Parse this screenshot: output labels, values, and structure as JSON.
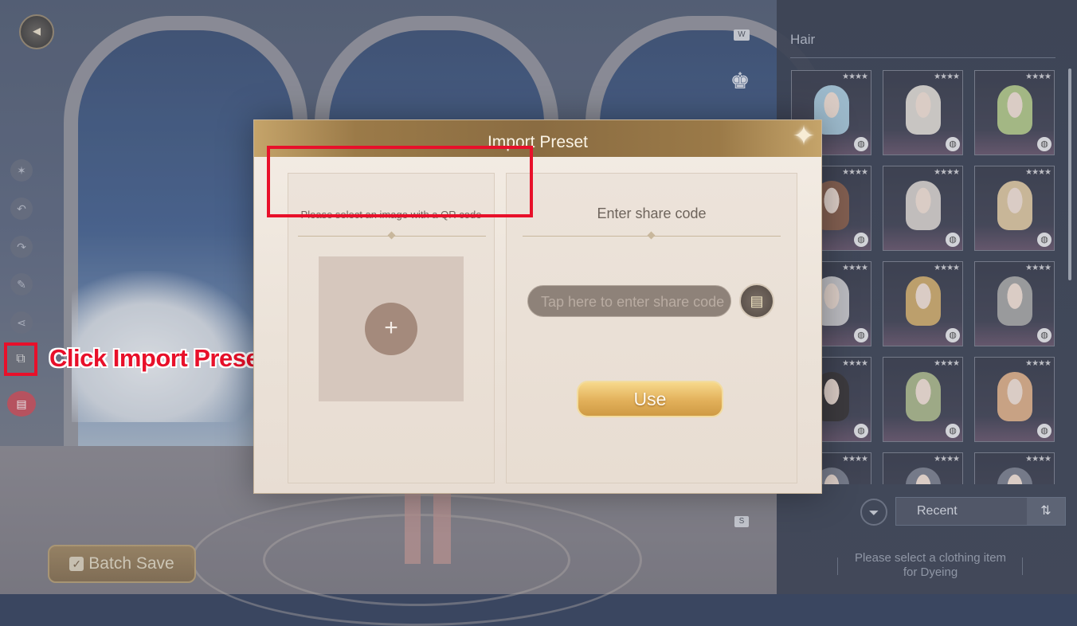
{
  "scene": {
    "key_w": "W",
    "key_s": "S",
    "outfit_icon": "outfit-icon"
  },
  "left_toolbar": {
    "back_icon": "back-arrow-icon",
    "tools": [
      "sparkle-icon",
      "undo-icon",
      "redo-icon",
      "brush-icon",
      "share-icon"
    ],
    "import_tool_icon": "import-icon",
    "book_icon": "book-icon",
    "batch_save_label": "Batch Save"
  },
  "annotation": {
    "instruction": "Click Import Preset button",
    "highlight_color": "#e8102a"
  },
  "right_panel": {
    "section_title": "Hair",
    "sort_label": "Recent",
    "dye_hint_line1": "Please select a clothing item",
    "dye_hint_line2": "for Dyeing",
    "hair_items": [
      {
        "stars": "★★★★",
        "color": "#9ec3d8"
      },
      {
        "stars": "★★★★",
        "color": "#d9d3cd"
      },
      {
        "stars": "★★★★",
        "color": "#a7c07a"
      },
      {
        "stars": "★★★★",
        "color": "#7a4a34"
      },
      {
        "stars": "★★★★",
        "color": "#cfc9c4"
      },
      {
        "stars": "★★★★",
        "color": "#d9bf95"
      },
      {
        "stars": "★★★★",
        "color": "#c6c4c8"
      },
      {
        "stars": "★★★★",
        "color": "#c9a15a"
      },
      {
        "stars": "★★★★",
        "color": "#9a9a9a"
      },
      {
        "stars": "★★★★",
        "color": "#1e1a1c"
      },
      {
        "stars": "★★★★",
        "color": "#9fae7c"
      },
      {
        "stars": "★★★★",
        "color": "#d8a47a"
      },
      {
        "stars": "★★★★",
        "color": "#6a6f80"
      },
      {
        "stars": "★★★★",
        "color": "#6a6f80"
      },
      {
        "stars": "★★★★",
        "color": "#6a6f80"
      }
    ]
  },
  "modal": {
    "title": "Import Preset",
    "qr_heading": "Please select an image with a QR code",
    "qr_add_symbol": "+",
    "code_heading": "Enter share code",
    "code_placeholder": "Tap here to enter share code",
    "paste_icon": "paste-icon",
    "use_label": "Use",
    "close_symbol": "✦"
  }
}
